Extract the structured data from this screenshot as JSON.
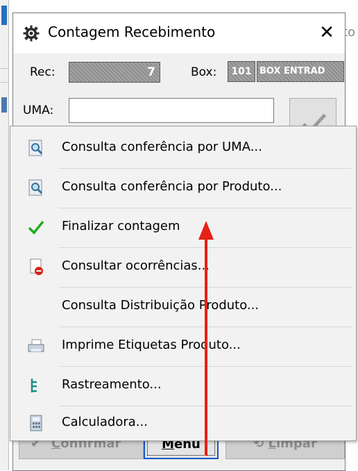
{
  "background": {
    "right_fragment": "to"
  },
  "dialog": {
    "title": "Contagem Recebimento",
    "close_glyph": "✕",
    "rec_label": "Rec:",
    "rec_value": "7",
    "box_label": "Box:",
    "box_code": "101",
    "box_name": "BOX ENTRAD",
    "uma_label": "UMA:",
    "uma_value": ""
  },
  "buttons": {
    "confirmar_prefix": "C",
    "confirmar_rest": "onfirmar",
    "menu_prefix": "M",
    "menu_rest": "enu",
    "limpar_prefix": "L",
    "limpar_rest": "impar"
  },
  "menu": {
    "items": [
      {
        "label": "Consulta conferência por UMA...",
        "icon": "magnifier-doc-icon"
      },
      {
        "label": "Consulta conferência por Produto...",
        "icon": "magnifier-doc-icon"
      },
      {
        "label": "Finalizar contagem",
        "icon": "green-check-icon"
      },
      {
        "label": "Consultar ocorrências...",
        "icon": "doc-stop-icon"
      },
      {
        "label": "Consulta Distribuição Produto...",
        "icon": ""
      },
      {
        "label": "Imprime Etiquetas Produto...",
        "icon": "printer-icon"
      },
      {
        "label": "Rastreamento...",
        "icon": "tree-icon"
      },
      {
        "label": "Calculadora...",
        "icon": "calculator-icon"
      }
    ]
  },
  "colors": {
    "arrow": "#e8201a",
    "focus": "#1a56c2",
    "check": "#1fae1f"
  }
}
